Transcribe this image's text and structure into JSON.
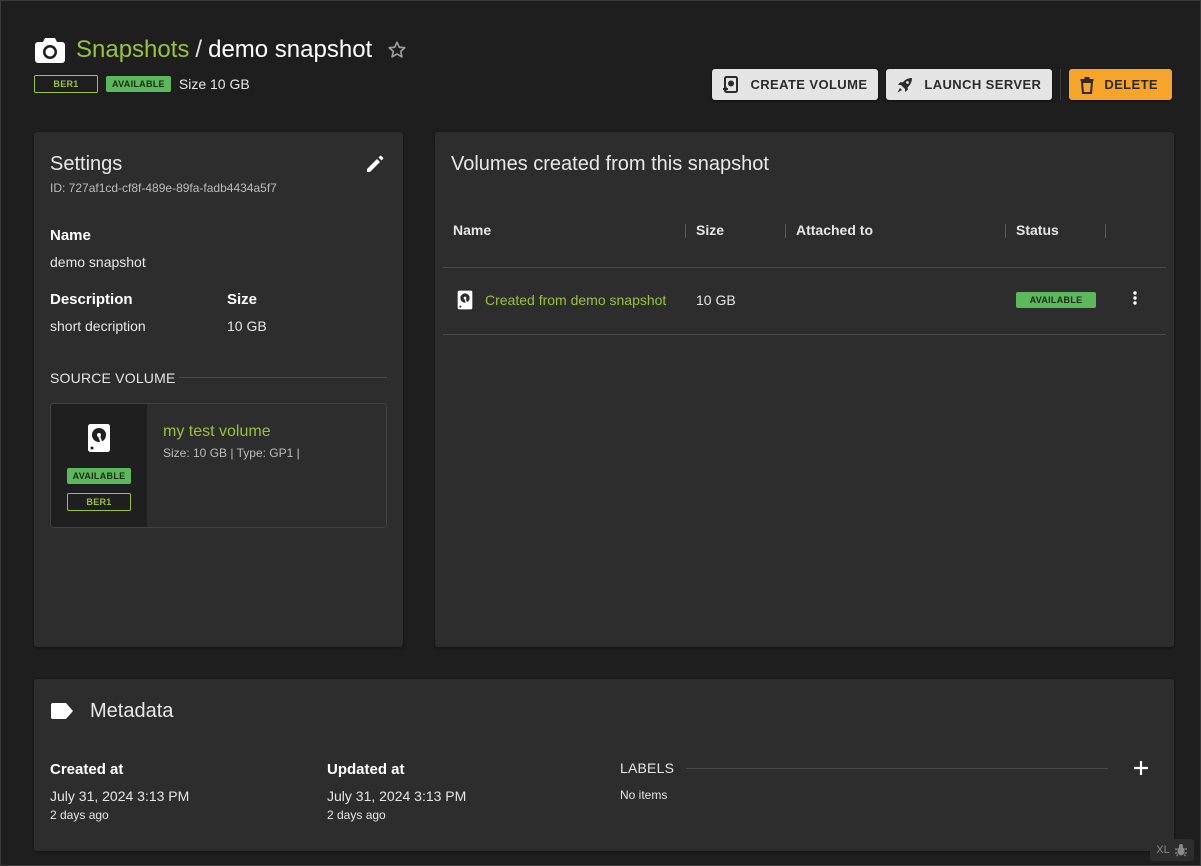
{
  "header": {
    "breadcrumb_root": "Snapshots",
    "breadcrumb_sep": "/",
    "title": "demo snapshot",
    "region": "BER1",
    "status": "AVAILABLE",
    "size_text": "Size 10 GB"
  },
  "actions": {
    "create_volume": "CREATE VOLUME",
    "launch_server": "LAUNCH SERVER",
    "delete": "DELETE"
  },
  "settings": {
    "title": "Settings",
    "id_text": "ID: 727af1cd-cf8f-489e-89fa-fadb4434a5f7",
    "name_label": "Name",
    "name_value": "demo snapshot",
    "description_label": "Description",
    "description_value": "short decription",
    "size_label": "Size",
    "size_value": "10 GB",
    "source_volume_title": "SOURCE VOLUME",
    "source_volume": {
      "name": "my test volume",
      "info": "Size: 10 GB | Type: GP1 |",
      "status": "AVAILABLE",
      "region": "BER1"
    }
  },
  "volumes": {
    "title": "Volumes created from this snapshot",
    "columns": [
      "Name",
      "Size",
      "Attached to",
      "Status"
    ],
    "rows": [
      {
        "name": "Created from demo snapshot",
        "size": "10 GB",
        "attached_to": "",
        "status": "AVAILABLE"
      }
    ]
  },
  "metadata": {
    "title": "Metadata",
    "created_label": "Created at",
    "created_value": "July 31, 2024 3:13 PM",
    "created_ago": "2 days ago",
    "updated_label": "Updated at",
    "updated_value": "July 31, 2024 3:13 PM",
    "updated_ago": "2 days ago",
    "labels_title": "LABELS",
    "labels_empty": "No items"
  },
  "badge": {
    "text": "XL"
  },
  "colors": {
    "background": "#1e1e1e",
    "card": "#2d2d2d",
    "accent_green": "#9bc23c",
    "status_green": "#5cb85c",
    "warning": "#f7a52a",
    "button_light": "#e4e4e4"
  },
  "icons": [
    "camera-icon",
    "star-outline-icon",
    "create-volume-icon",
    "rocket-icon",
    "trash-icon",
    "pencil-icon",
    "hard-disk-icon",
    "more-vertical-icon",
    "tag-icon",
    "plus-icon",
    "bug-icon"
  ]
}
